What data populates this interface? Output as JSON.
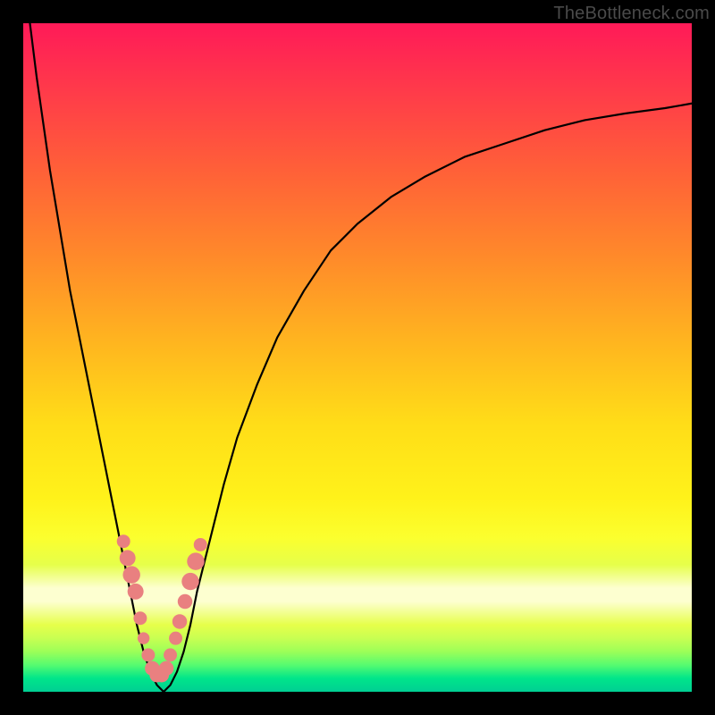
{
  "watermark": "TheBottleneck.com",
  "chart_data": {
    "type": "line",
    "title": "",
    "subtitle": "",
    "xlabel": "",
    "ylabel": "",
    "xlim": [
      0,
      100
    ],
    "ylim": [
      0,
      100
    ],
    "grid": false,
    "legend": false,
    "annotations": [],
    "series": [
      {
        "name": "bottleneck-curve",
        "x": [
          1,
          2,
          3,
          4,
          5,
          6,
          7,
          8,
          9,
          10,
          11,
          12,
          13,
          14,
          15,
          16,
          17,
          18,
          19,
          20,
          21,
          22,
          23,
          24,
          25,
          26,
          28,
          30,
          32,
          35,
          38,
          42,
          46,
          50,
          55,
          60,
          66,
          72,
          78,
          84,
          90,
          96,
          100
        ],
        "y": [
          100,
          92,
          85,
          78,
          72,
          66,
          60,
          55,
          50,
          45,
          40,
          35,
          30,
          25,
          20,
          15,
          10,
          6,
          3,
          1,
          0,
          1,
          3,
          6,
          10,
          15,
          23,
          31,
          38,
          46,
          53,
          60,
          66,
          70,
          74,
          77,
          80,
          82,
          84,
          85.5,
          86.5,
          87.3,
          88
        ]
      }
    ],
    "highlight_points": {
      "name": "highlight-dots",
      "color": "#e98080",
      "points": [
        {
          "x": 15.0,
          "y": 22.5,
          "r": 1.0
        },
        {
          "x": 15.6,
          "y": 20.0,
          "r": 1.2
        },
        {
          "x": 16.2,
          "y": 17.5,
          "r": 1.3
        },
        {
          "x": 16.8,
          "y": 15.0,
          "r": 1.2
        },
        {
          "x": 17.5,
          "y": 11.0,
          "r": 1.0
        },
        {
          "x": 18.0,
          "y": 8.0,
          "r": 0.9
        },
        {
          "x": 18.7,
          "y": 5.5,
          "r": 1.0
        },
        {
          "x": 19.3,
          "y": 3.5,
          "r": 1.1
        },
        {
          "x": 20.0,
          "y": 2.5,
          "r": 1.1
        },
        {
          "x": 20.7,
          "y": 2.5,
          "r": 1.1
        },
        {
          "x": 21.4,
          "y": 3.5,
          "r": 1.1
        },
        {
          "x": 22.0,
          "y": 5.5,
          "r": 1.0
        },
        {
          "x": 22.8,
          "y": 8.0,
          "r": 1.0
        },
        {
          "x": 23.4,
          "y": 10.5,
          "r": 1.1
        },
        {
          "x": 24.2,
          "y": 13.5,
          "r": 1.1
        },
        {
          "x": 25.0,
          "y": 16.5,
          "r": 1.3
        },
        {
          "x": 25.8,
          "y": 19.5,
          "r": 1.3
        },
        {
          "x": 26.5,
          "y": 22.0,
          "r": 1.0
        }
      ]
    }
  }
}
